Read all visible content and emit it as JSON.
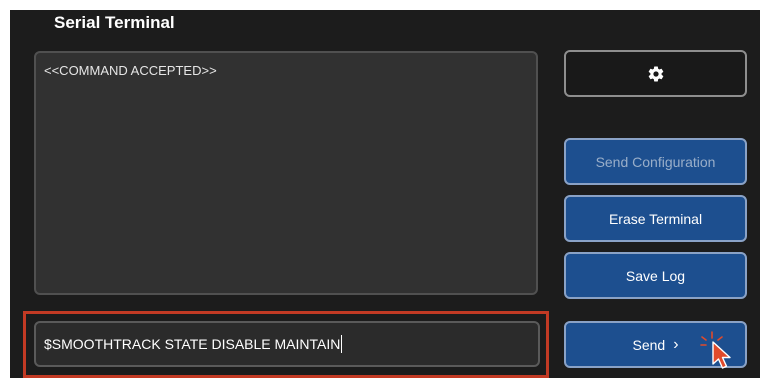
{
  "app": {
    "title": "Serial Terminal"
  },
  "terminal": {
    "lines": [
      "<<COMMAND ACCEPTED>>"
    ]
  },
  "command_input": {
    "value": "$SMOOTHTRACK STATE DISABLE MAINTAIN"
  },
  "buttons": {
    "settings_icon": "gear-icon",
    "send_configuration": "Send Configuration",
    "erase_terminal": "Erase Terminal",
    "save_log": "Save Log",
    "send": "Send",
    "send_icon": "chevron-right-icon"
  },
  "colors": {
    "background": "#1c1c1c",
    "panel": "#313131",
    "button_blue": "#1d4f8f",
    "highlight_red": "#c23a24",
    "cursor_red": "#e04a2b"
  }
}
